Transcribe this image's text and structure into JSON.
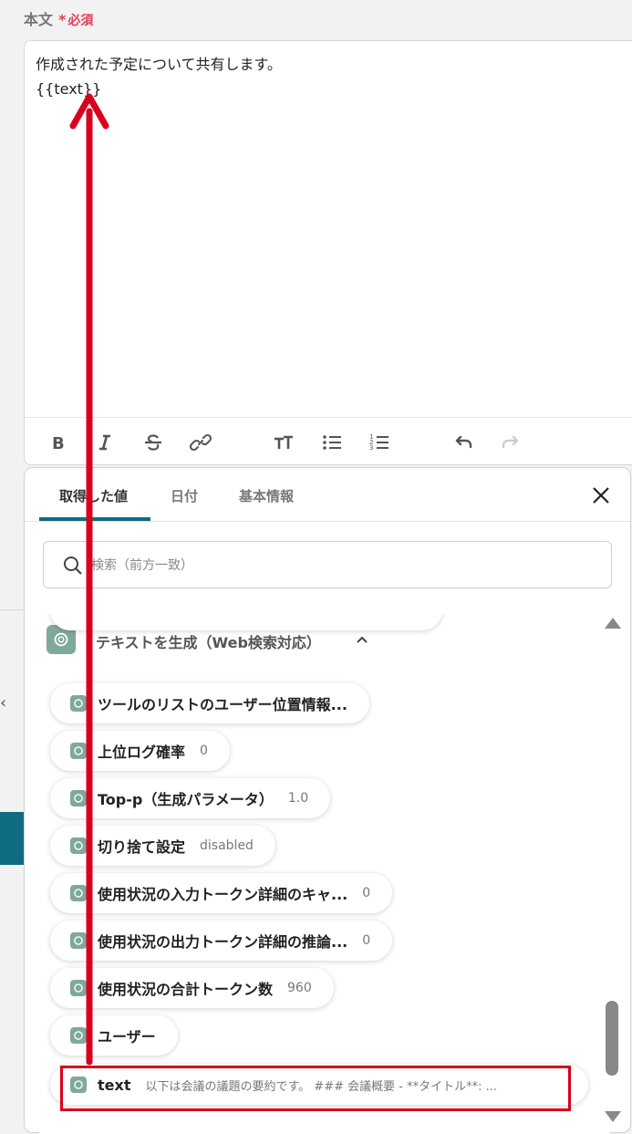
{
  "field": {
    "label": "本文",
    "required_mark": "*",
    "required_text": "必須"
  },
  "editor": {
    "line1": "作成された予定について共有します。",
    "line2": "{{text}}"
  },
  "toolbar": {
    "bold_icon": "bold-icon",
    "italic_icon": "italic-icon",
    "strike_icon": "strikethrough-icon",
    "link_icon": "link-icon",
    "heading_icon": "text-size-icon",
    "bullet_icon": "bullet-list-icon",
    "ordered_icon": "numbered-list-icon",
    "undo_icon": "undo-icon",
    "redo_icon": "redo-icon"
  },
  "panel": {
    "tabs": [
      {
        "label": "取得した値"
      },
      {
        "label": "日付"
      },
      {
        "label": "基本情報"
      }
    ],
    "search_placeholder": "検索（前方一致）",
    "group_title": "テキストを生成（Web検索対応）",
    "items": [
      {
        "name": "ツールのリストのユーザー位置情報...",
        "value": ""
      },
      {
        "name": "上位ログ確率",
        "value": "0"
      },
      {
        "name": "Top-p（生成パラメータ）",
        "value": "1.0"
      },
      {
        "name": "切り捨て設定",
        "value": "disabled"
      },
      {
        "name": "使用状況の入力トークン詳細のキャ...",
        "value": "0"
      },
      {
        "name": "使用状況の出力トークン詳細の推論...",
        "value": "0"
      },
      {
        "name": "使用状況の合計トークン数",
        "value": "960"
      },
      {
        "name": "ユーザー",
        "value": ""
      },
      {
        "name": "text",
        "value": "以下は会議の議題の要約です。 ### 会議概要 - **タイトル**: ..."
      }
    ]
  },
  "colors": {
    "accent": "#0f6b80",
    "required": "#e0405a",
    "annotation": "#d9001b",
    "gpt": "#7fa998"
  }
}
